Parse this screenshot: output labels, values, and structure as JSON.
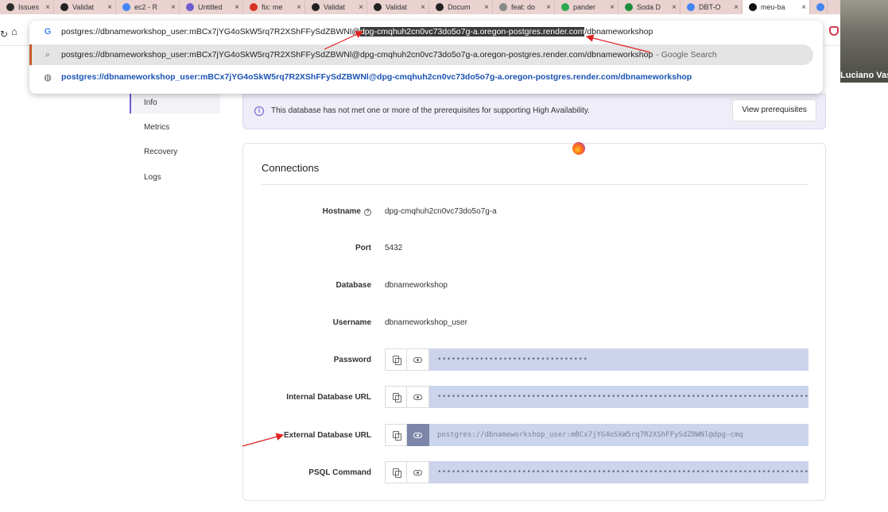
{
  "tabs": [
    {
      "title": "Issues",
      "color": "#2d2d2d",
      "width": 68
    },
    {
      "title": "Validat",
      "color": "#222222",
      "width": 78
    },
    {
      "title": "ec2 - R",
      "color": "#4285f4",
      "width": 80
    },
    {
      "title": "Untitled",
      "color": "#6c5ccf",
      "width": 80
    },
    {
      "title": "fix: me",
      "color": "#d93025",
      "width": 78
    },
    {
      "title": "Validat",
      "color": "#222222",
      "width": 78
    },
    {
      "title": "Validat",
      "color": "#222222",
      "width": 78
    },
    {
      "title": "Docum",
      "color": "#222222",
      "width": 80
    },
    {
      "title": "feat: do",
      "color": "#888888",
      "width": 78
    },
    {
      "title": "pander",
      "color": "#2ca94f",
      "width": 80
    },
    {
      "title": "Soda D",
      "color": "#1e8e3e",
      "width": 78
    },
    {
      "title": "DBT-O",
      "color": "#4285f4",
      "width": 78
    },
    {
      "title": "meu-ba",
      "color": "#111111",
      "width": 85,
      "active": true
    },
    {
      "title": "",
      "color": "#4285f4",
      "width": 22
    }
  ],
  "omnibox": {
    "row1_prefix": "postgres://dbnameworkshop_user:mBCx7jYG4oSkW5rq7R2XShFFySdZBWNl@",
    "row1_highlight": "dpg-cmqhuh2cn0vc73do5o7g-a.oregon-postgres.render.com",
    "row1_suffix": "/dbnameworkshop",
    "row2_text": "postgres://dbnameworkshop_user:mBCx7jYG4oSkW5rq7R2XShFFySdZBWNl@dpg-cmqhuh2cn0vc73do5o7g-a.oregon-postgres.render.com/dbnameworkshop",
    "row2_suffix": "- Google Search",
    "row3_text": "postgres://dbnameworkshop_user:mBCx7jYG4oSkW5rq7R2XShFFySdZBWNl@dpg-cmqhuh2cn0vc73do5o7g-a.oregon-postgres.render.com/dbnameworkshop"
  },
  "webcam": {
    "name": "Luciano Vas"
  },
  "sidebar": {
    "items": [
      {
        "label": "Info",
        "active": true
      },
      {
        "label": "Metrics"
      },
      {
        "label": "Recovery"
      },
      {
        "label": "Logs"
      }
    ]
  },
  "banner": {
    "message": "This database has not met one or more of the prerequisites for supporting High Availability.",
    "button": "View prerequisites"
  },
  "connections": {
    "title": "Connections",
    "hostname_label": "Hostname",
    "hostname_value": "dpg-cmqhuh2cn0vc73do5o7g-a",
    "port_label": "Port",
    "port_value": "5432",
    "database_label": "Database",
    "database_value": "dbnameworkshop",
    "username_label": "Username",
    "username_value": "dbnameworkshop_user",
    "password_label": "Password",
    "password_value": "••••••••••••••••••••••••••••••••",
    "internal_url_label": "Internal Database URL",
    "internal_url_value": "••••••••••••••••••••••••••••••••••••••••••••••••••••••••••••••••••••••••••••••••",
    "external_url_label": "External Database URL",
    "external_url_value": "postgres://dbnameworkshop_user:mBCx7jYG4oSkW5rq7R2XShFFySdZBWNl@dpg-cmq",
    "psql_label": "PSQL Command",
    "psql_value": "••••••••••••••••••••••••••••••••••••••••••••••••••••••••••••••••••••••••••••••••"
  },
  "colors": {
    "accent": "#6c5ccf",
    "arrow": "#e0201e",
    "secret_bg": "#cbd4ec"
  }
}
